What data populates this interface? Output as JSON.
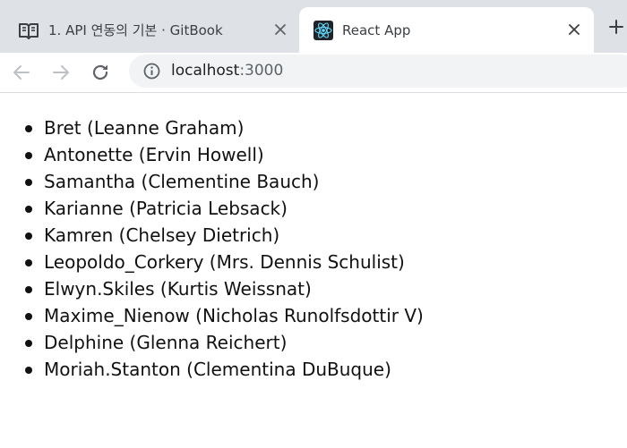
{
  "browser": {
    "tabs": [
      {
        "title": "1. API 연동의 기본 · GitBook",
        "icon": "gitbook-book-icon",
        "active": false
      },
      {
        "title": "React App",
        "icon": "react-logo-icon",
        "active": true
      }
    ],
    "address_bar": {
      "host": "localhost",
      "port": ":3000"
    }
  },
  "users": [
    {
      "username": "Bret",
      "name": "Leanne Graham"
    },
    {
      "username": "Antonette",
      "name": "Ervin Howell"
    },
    {
      "username": "Samantha",
      "name": "Clementine Bauch"
    },
    {
      "username": "Karianne",
      "name": "Patricia Lebsack"
    },
    {
      "username": "Kamren",
      "name": "Chelsey Dietrich"
    },
    {
      "username": "Leopoldo_Corkery",
      "name": "Mrs. Dennis Schulist"
    },
    {
      "username": "Elwyn.Skiles",
      "name": "Kurtis Weissnat"
    },
    {
      "username": "Maxime_Nienow",
      "name": "Nicholas Runolfsdottir V"
    },
    {
      "username": "Delphine",
      "name": "Glenna Reichert"
    },
    {
      "username": "Moriah.Stanton",
      "name": "Clementina DuBuque"
    }
  ]
}
